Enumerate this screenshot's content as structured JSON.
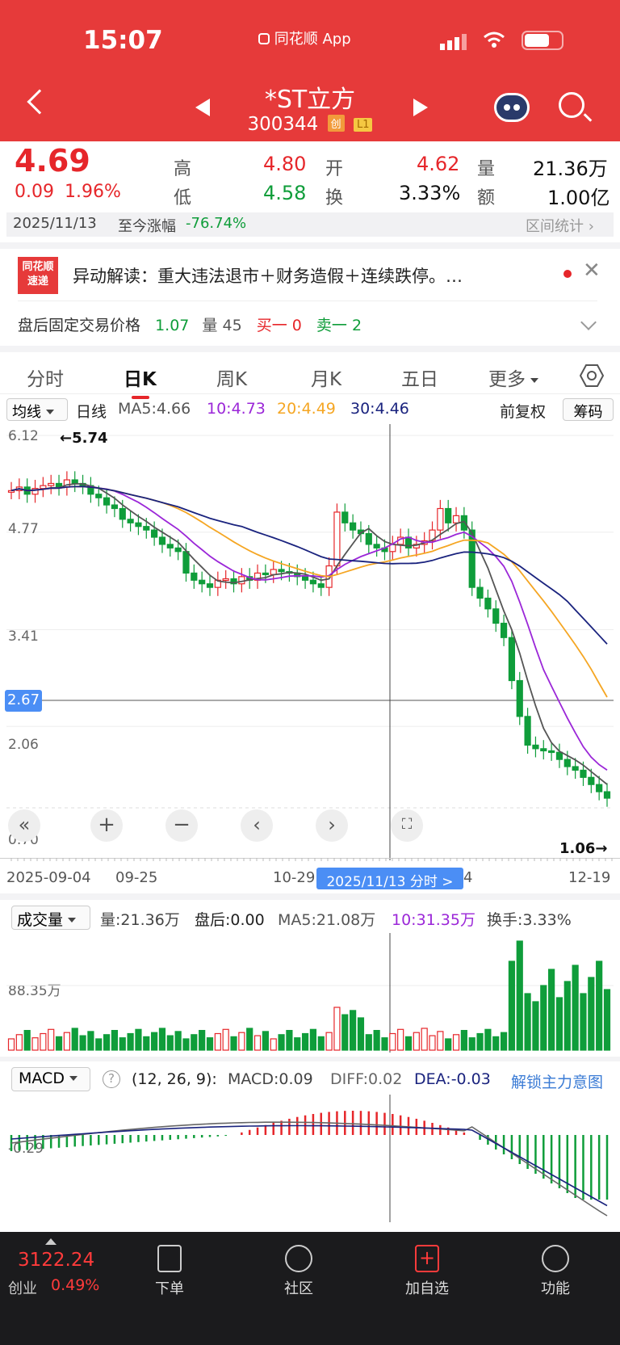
{
  "status_bar": {
    "time": "15:07",
    "app_label": "同花顺 App"
  },
  "header": {
    "title": "*ST立方",
    "code": "300344",
    "tag1": "创",
    "tag2": "L1"
  },
  "quote": {
    "price": "4.69",
    "change": "0.09",
    "change_pct": "1.96%",
    "high_label": "高",
    "high": "4.80",
    "low_label": "低",
    "low": "4.58",
    "open_label": "开",
    "open": "4.62",
    "turnover_label": "换",
    "turnover": "3.33%",
    "volume_label": "量",
    "volume": "21.36万",
    "amount_label": "额",
    "amount": "1.00亿",
    "date": "2025/11/13",
    "ytd_label": "至今涨幅",
    "ytd": "-76.74%",
    "range_stats": "区间统计"
  },
  "alert": {
    "logo_top": "同花顺",
    "logo_bottom": "速递",
    "text": "异动解读：重大违法退市＋财务造假＋连续跌停。…",
    "after_hours_label": "盘后固定交易价格",
    "after_price": "1.07",
    "after_vol_label": "量",
    "after_vol": "45",
    "buy_label": "买一",
    "buy": "0",
    "sell_label": "卖一",
    "sell": "2"
  },
  "tabs": [
    "分时",
    "日K",
    "周K",
    "月K",
    "五日",
    "更多"
  ],
  "ma_row": {
    "selector": "均线",
    "period": "日线",
    "ma5": "MA5:4.66",
    "ma10": "10:4.73",
    "ma20": "20:4.49",
    "ma30": "30:4.46",
    "adjust": "前复权",
    "chips": "筹码"
  },
  "kline": {
    "y_labels": [
      "6.12",
      "4.77",
      "3.41",
      "2.06",
      "0.70"
    ],
    "crosshair_price": "2.67",
    "high_marker": "←5.74",
    "low_marker": "1.06→",
    "x_labels": [
      "2025-09-04",
      "09-25",
      "10-29",
      "4",
      "12-19"
    ],
    "crosshair_date": "2025/11/13 分时 >"
  },
  "volume_panel": {
    "selector": "成交量",
    "vol": "量:21.36万",
    "after": "盘后:0.00",
    "ma5": "MA5:21.08万",
    "ma10": "10:31.35万",
    "turnover": "换手:3.33%",
    "y_label": "88.35万"
  },
  "macd_panel": {
    "selector": "MACD",
    "help": "?",
    "params": "(12, 26, 9):",
    "macd": "MACD:0.09",
    "diff": "DIFF:0.02",
    "dea": "DEA:-0.03",
    "unlock": "解锁主力意图",
    "y_label": "-0.29"
  },
  "bottom_bar": {
    "index_value": "3122.24",
    "index_name": "创业",
    "index_pct": "0.49%",
    "items": [
      "下单",
      "社区",
      "加自选",
      "功能"
    ]
  },
  "colors": {
    "header": "#e63a3a",
    "up": "#e6262a",
    "down": "#0f9d3a",
    "ma5": "#555555",
    "ma10": "#9b27d8",
    "ma20": "#f5a623",
    "ma30": "#1a237e"
  }
}
